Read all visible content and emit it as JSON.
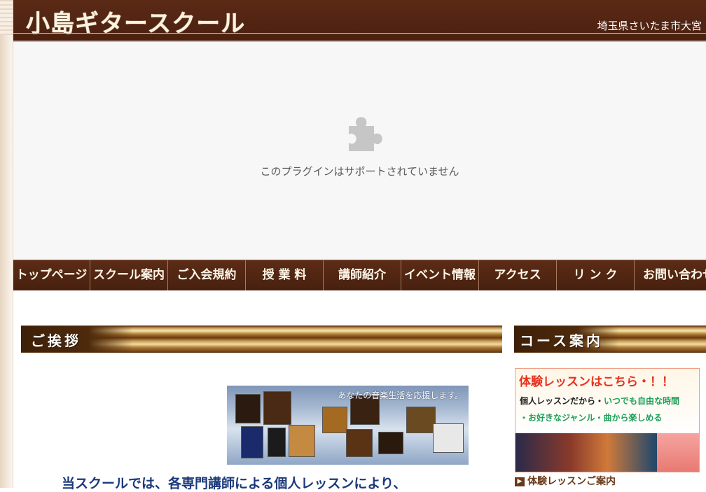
{
  "header": {
    "site_title": "小島ギタースクール",
    "location": "埼玉県さいたま市大宮"
  },
  "plugin": {
    "icon": "puzzle-piece-icon",
    "message": "このプラグインはサポートされていません"
  },
  "nav": {
    "items": [
      {
        "label": "トップページ"
      },
      {
        "label": "スクール案内"
      },
      {
        "label": "ご入会規約"
      },
      {
        "label": "授 業 料"
      },
      {
        "label": "講師紹介"
      },
      {
        "label": "イベント情報"
      },
      {
        "label": "アクセス"
      },
      {
        "label": "リ ン ク"
      },
      {
        "label": "お問い合わせ"
      }
    ]
  },
  "main": {
    "section_title": "ご挨拶",
    "banner_caption": "あなたの音楽生活を応援します。",
    "intro_text": "当スクールでは、各専門講師による個人レッスンにより、"
  },
  "sidebar": {
    "section_title": "コース案内",
    "banner": {
      "headline": "体験レッスンはこちら・！！",
      "line1_prefix": "個人レッスンだから・",
      "line1_highlight": "いつでも自由な時間",
      "line2": "・お好きなジャンル・曲から楽しめる"
    },
    "link_label": "体験レッスンご案内"
  },
  "colors": {
    "header_bg": "#4b2010",
    "nav_bg": "#4f2412",
    "plugin_bg": "#f7f7f7",
    "intro_text": "#1b3a7a",
    "banner_red": "#e8301e",
    "banner_green": "#1fa05a"
  }
}
